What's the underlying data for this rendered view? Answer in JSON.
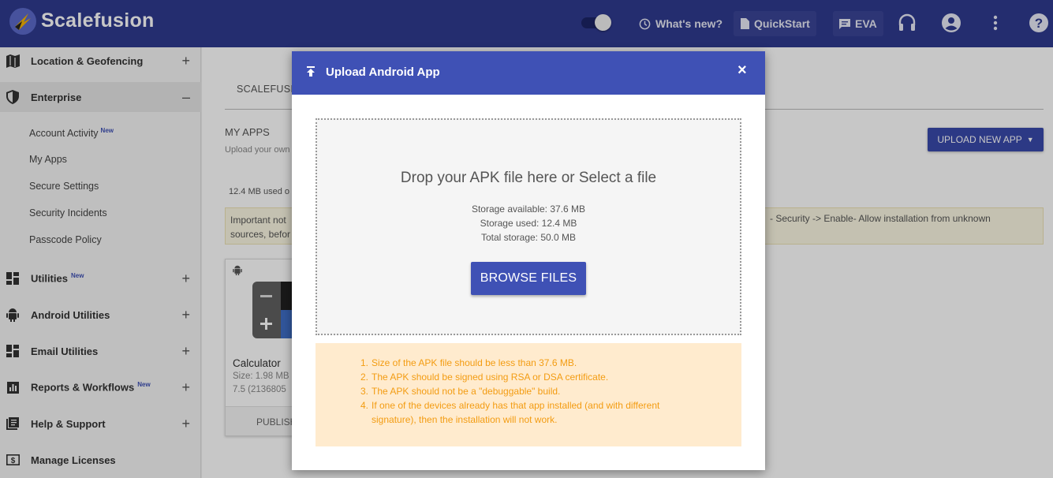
{
  "topbar": {
    "brand": "Scalefusion",
    "whats_new": "What's new?",
    "quickstart": "QuickStart",
    "eva": "EVA",
    "icons": [
      "toggle",
      "clock-icon",
      "doc-icon",
      "chat-icon",
      "headset-icon",
      "account-icon",
      "more-vert-icon",
      "help-icon"
    ]
  },
  "sidebar": {
    "items": [
      {
        "label": "Location & Geofencing",
        "icon": "map-icon",
        "expander": "+"
      },
      {
        "label": "Enterprise",
        "icon": "shield-icon",
        "expander": "–"
      },
      {
        "label": "Utilities",
        "badge": "New",
        "icon": "dashboard-icon",
        "expander": "+"
      },
      {
        "label": "Android Utilities",
        "icon": "android-icon",
        "expander": "+"
      },
      {
        "label": "Email Utilities",
        "icon": "dashboard-icon",
        "expander": "+"
      },
      {
        "label": "Reports & Workflows",
        "badge": "New",
        "icon": "chart-icon",
        "expander": "+"
      },
      {
        "label": "Help & Support",
        "icon": "book-icon",
        "expander": "+"
      },
      {
        "label": "Manage Licenses",
        "icon": "license-icon"
      }
    ],
    "sub_items": [
      {
        "label": "Account Activity",
        "badge": "New"
      },
      {
        "label": "My Apps"
      },
      {
        "label": "Secure Settings"
      },
      {
        "label": "Security Incidents"
      },
      {
        "label": "Passcode Policy"
      }
    ]
  },
  "main": {
    "tab": "SCALEFUSIO",
    "section_title": "MY APPS",
    "section_sub": "Upload your own",
    "used_text": "12.4 MB used o",
    "important_left_1": "Important not",
    "important_left_2": "sources, befor",
    "important_right": "- Security -> Enable- Allow installation from unknown",
    "upload_button": "UPLOAD NEW APP",
    "app_card": {
      "name": "Calculator",
      "size": "Size: 1.98 MB",
      "version": "7.5 (2136805",
      "publish": "PUBLISH"
    }
  },
  "modal": {
    "title": "Upload Android App",
    "close": "×",
    "drop_text": "Drop your APK file here or Select a file",
    "storage_available": "Storage available: 37.6 MB",
    "storage_used": "Storage used: 12.4 MB",
    "total_storage": "Total storage: 50.0 MB",
    "browse_button": "BROWSE FILES",
    "notes": [
      {
        "num": "1.",
        "text": "Size of the APK file should be less than 37.6 MB."
      },
      {
        "num": "2.",
        "text": "The APK should be signed using RSA or DSA certificate."
      },
      {
        "num": "3.",
        "text": "The APK should not be a \"debuggable\" build."
      },
      {
        "num": "4.",
        "text": "If one of the devices already has that app installed (and with different"
      },
      {
        "num": "",
        "text": "signature), then the installation will not work."
      }
    ],
    "note_color": "#f39c12",
    "accent": "#3f51b5"
  }
}
